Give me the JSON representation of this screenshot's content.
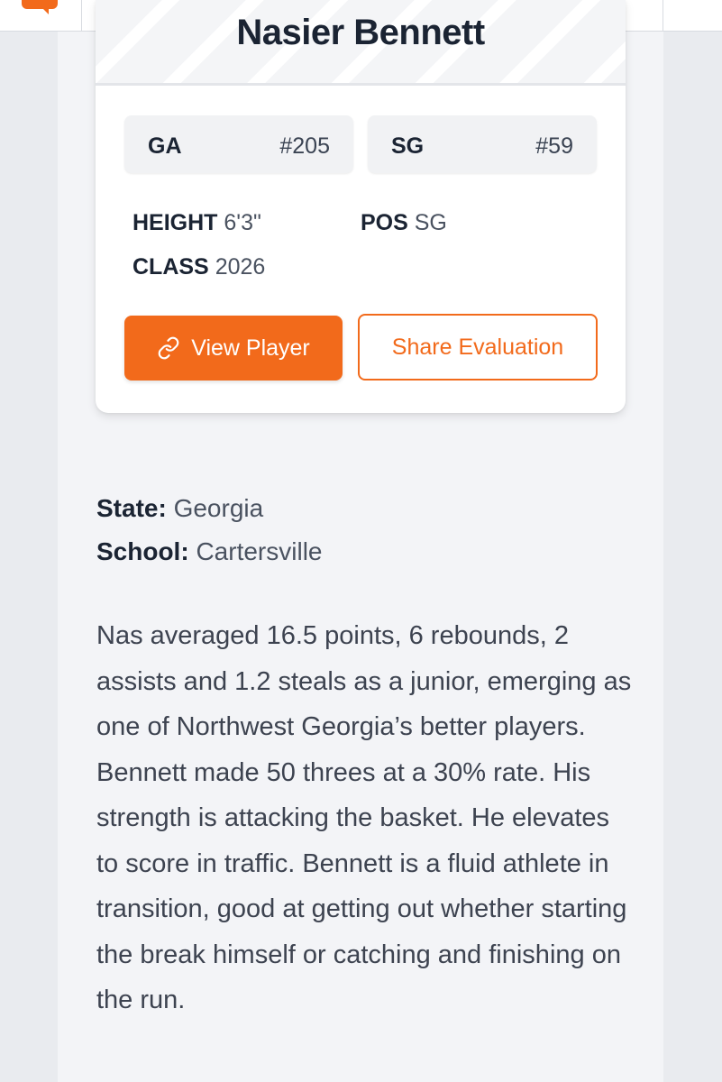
{
  "player": {
    "name": "Nasier Bennett",
    "state_rank": {
      "label": "GA",
      "value": "#205"
    },
    "position_rank": {
      "label": "SG",
      "value": "#59"
    },
    "height": {
      "label": "HEIGHT",
      "value": "6'3\""
    },
    "class": {
      "label": "CLASS",
      "value": "2026"
    },
    "pos": {
      "label": "POS",
      "value": "SG"
    }
  },
  "actions": {
    "view_player": "View Player",
    "share_evaluation": "Share Evaluation"
  },
  "details": {
    "state_label": "State:",
    "state_value": "Georgia",
    "school_label": "School:",
    "school_value": "Cartersville"
  },
  "bio": "Nas averaged 16.5 points, 6 rebounds, 2 assists and 1.2 steals as a junior, emerging as one of Northwest Georgia’s better players. Bennett made 50 threes at a 30% rate. His strength is attacking the basket. He elevates to score in traffic. Bennett is a fluid athlete in transition, good at getting out whether starting the break himself or catching and finishing on the run.",
  "colors": {
    "accent": "#f26a1b",
    "text_dark": "#1b2433",
    "background": "#e9ebef"
  },
  "icons": {
    "logo": "chat-bubble-logo",
    "view_player": "link-icon"
  }
}
